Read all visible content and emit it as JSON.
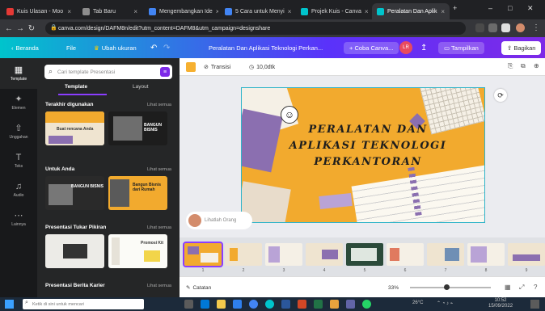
{
  "browser": {
    "tabs": [
      {
        "label": "Kuis Ulasan - Moo",
        "color": "#e53935"
      },
      {
        "label": "Tab Baru",
        "color": "#8d8d8d"
      },
      {
        "label": "Mengembangkan Ide",
        "color": "#4285f4"
      },
      {
        "label": "5 Cara untuk Menyi",
        "color": "#4285f4"
      },
      {
        "label": "Projek Kuis - Canva",
        "color": "#4285f4"
      },
      {
        "label": "Peralatan Dan Aplik",
        "color": "#4285f4"
      }
    ],
    "url": "canva.com/design/DAFM8n/edit?utm_content=DAFM8&utm_campaign=designshare",
    "window_controls": [
      "–",
      "□",
      "✕"
    ]
  },
  "canva_bar": {
    "beranda": "Beranda",
    "file": "File",
    "ubah_ukuran": "Ubah ukuran",
    "undo": "↶",
    "doc_title": "Peralatan Dan Aplikasi Teknologi Perkan...",
    "coba_canva": "+ Coba Canva...",
    "avatar_initials": "LR",
    "stats": "↥",
    "tampilkan": "Tampilkan",
    "bagikan": "Bagikan"
  },
  "rail": [
    {
      "label": "Template",
      "icon": "▦"
    },
    {
      "label": "Elemen",
      "icon": "✦"
    },
    {
      "label": "Unggahan",
      "icon": "⇧"
    },
    {
      "label": "Teks",
      "icon": "T"
    },
    {
      "label": "Audio",
      "icon": "♫"
    },
    {
      "label": "Lainnya",
      "icon": "⋯"
    }
  ],
  "panel": {
    "search_placeholder": "Cari template Presentasi",
    "tabs": [
      "Template",
      "Layout"
    ],
    "sections": [
      {
        "title": "Terakhir digunakan",
        "see_all": "Lihat semua"
      },
      {
        "title": "Untuk Anda",
        "see_all": "Lihat semua"
      },
      {
        "title": "Presentasi Tukar Pikiran",
        "see_all": "Lihat semua"
      },
      {
        "title": "Presentasi Berita Karier",
        "see_all": "Lihat semua"
      }
    ],
    "thumb_texts": [
      "Buat rencana Anda",
      "BANGUN BISNIS",
      "BANGUN BISNIS",
      "Bangun Bisnis dari Rumah",
      "",
      "Promosi Kit"
    ]
  },
  "editor": {
    "toolbar": {
      "font_label": "Transisi",
      "duration": "10,0dtk",
      "right_icons": [
        "⎘",
        "⧉",
        "⊕"
      ]
    },
    "slide": {
      "title_lines": [
        "PERALATAN DAN",
        "APLIKASI TEKNOLOGI",
        "PERKANTORAN"
      ],
      "colors": {
        "bg": "#f2aa2e",
        "purple": "#8b6fb0",
        "lilac": "#b9a3d6",
        "paper": "#f5f0e6"
      }
    },
    "commenter": "Lihatlah Orang",
    "filmstrip": {
      "pages": [
        "1",
        "2",
        "3",
        "4",
        "5",
        "6",
        "7",
        "8",
        "9"
      ]
    },
    "bottom": {
      "notes": "Catatan",
      "zoom": "33%",
      "zoom_fraction": 0.45
    }
  },
  "taskbar": {
    "search_placeholder": "Ketik di sini untuk mencari",
    "time": "10:52",
    "date": "15/09/2022",
    "weather": "26°C"
  }
}
